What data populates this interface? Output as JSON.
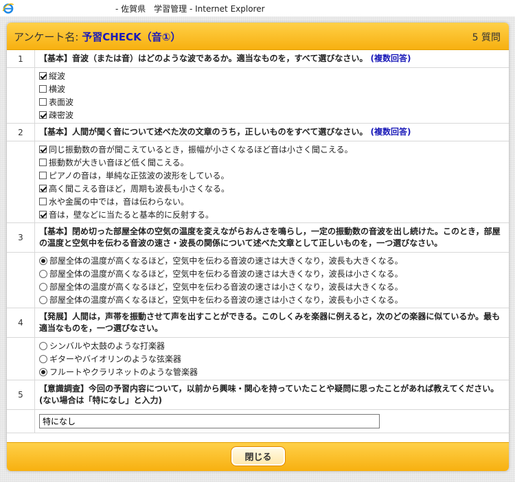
{
  "window": {
    "title": "- 佐賀県　学習管理 - Internet Explorer",
    "icon": "internet-explorer-icon"
  },
  "survey": {
    "label_prefix": "アンケート名:",
    "name": "予習CHECK（音①）",
    "question_count": "5 質問"
  },
  "questions": [
    {
      "number": "1",
      "text": "【基本】音波（または音）はどのような波であるか。適当なものを，すべて選びなさい。",
      "tag": "(複数回答)",
      "type": "checkbox",
      "options": [
        {
          "label": "縦波",
          "checked": true
        },
        {
          "label": "横波",
          "checked": false
        },
        {
          "label": "表面波",
          "checked": false
        },
        {
          "label": "疎密波",
          "checked": true
        }
      ]
    },
    {
      "number": "2",
      "text": "【基本】人間が聞く音について述べた次の文章のうち，正しいものをすべて選びなさい。",
      "tag": "(複数回答)",
      "type": "checkbox",
      "options": [
        {
          "label": "同じ振動数の音が聞こえているとき，振幅が小さくなるほど音は小さく聞こえる。",
          "checked": true
        },
        {
          "label": "振動数が大きい音ほど低く聞こえる。",
          "checked": false
        },
        {
          "label": "ピアノの音は，単純な正弦波の波形をしている。",
          "checked": false
        },
        {
          "label": "高く聞こえる音ほど，周期も波長も小さくなる。",
          "checked": true
        },
        {
          "label": "水や金属の中では，音は伝わらない。",
          "checked": false
        },
        {
          "label": "音は，壁などに当たると基本的に反射する。",
          "checked": true
        }
      ]
    },
    {
      "number": "3",
      "text": "【基本】閉め切った部屋全体の空気の温度を変えながらおんさを鳴らし，一定の振動数の音波を出し続けた。このとき，部屋の温度と空気中を伝わる音波の速さ・波長の関係について述べた文章として正しいものを，一つ選びなさい。",
      "tag": "",
      "type": "radio",
      "options": [
        {
          "label": "部屋全体の温度が高くなるほど，空気中を伝わる音波の速さは大きくなり，波長も大きくなる。",
          "checked": true
        },
        {
          "label": "部屋全体の温度が高くなるほど，空気中を伝わる音波の速さは大きくなり，波長は小さくなる。",
          "checked": false
        },
        {
          "label": "部屋全体の温度が高くなるほど，空気中を伝わる音波の速さは小さくなり，波長は大きくなる。",
          "checked": false
        },
        {
          "label": "部屋全体の温度が高くなるほど，空気中を伝わる音波の速さは小さくなり，波長も小さくなる。",
          "checked": false
        }
      ]
    },
    {
      "number": "4",
      "text": "【発展】人間は，声帯を振動させて声を出すことができる。このしくみを楽器に例えると，次のどの楽器に似ているか。最も適当なものを，一つ選びなさい。",
      "tag": "",
      "type": "radio",
      "options": [
        {
          "label": "シンバルや太鼓のような打楽器",
          "checked": false
        },
        {
          "label": "ギターやバイオリンのような弦楽器",
          "checked": false
        },
        {
          "label": "フルートやクラリネットのような管楽器",
          "checked": true
        }
      ]
    },
    {
      "number": "5",
      "text": "【意識調査】今回の予習内容について，以前から興味・関心を持っていたことや疑問に思ったことがあれば教えてください。(ない場合は「特になし」と入力)",
      "tag": "",
      "type": "text",
      "value": "特になし"
    }
  ],
  "footer": {
    "close_label": "閉じる"
  },
  "colors": {
    "header": "#f9bb1f",
    "accent_text": "#1a1ab8"
  }
}
